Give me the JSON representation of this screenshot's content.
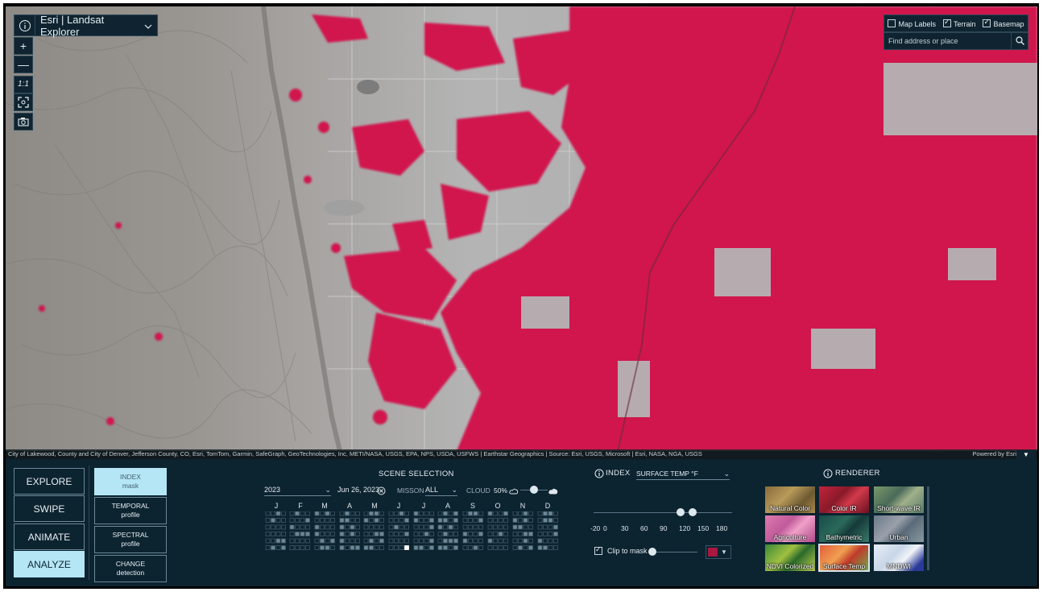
{
  "app": {
    "title": "Esri | Landsat Explorer"
  },
  "map": {
    "layer_toggles": [
      {
        "label": "Map Labels",
        "checked": false
      },
      {
        "label": "Terrain",
        "checked": true
      },
      {
        "label": "Basemap",
        "checked": true
      }
    ],
    "search_placeholder": "Find address or place",
    "attribution": "City of Lakewood, County and City of Denver, Jefferson County, CO, Esri, TomTom, Garmin, SafeGraph, GeoTechnologies, Inc, METI/NASA, USGS, EPA, NPS, USDA, USFWS | Earthstar Geographics | Source: Esri, USGS, Microsoft | Esri, NASA, NGA, USGS",
    "powered_by": "Powered by Esri",
    "zoom_in": "+",
    "zoom_out": "—",
    "scale_1to1": "1:1",
    "mask_color": "#d0124d"
  },
  "modes": [
    "EXPLORE",
    "SWIPE",
    "ANIMATE",
    "ANALYZE"
  ],
  "active_mode": "ANALYZE",
  "analyze_tools": [
    {
      "line1": "INDEX",
      "line2": "mask",
      "active": true
    },
    {
      "line1": "TEMPORAL",
      "line2": "profile",
      "active": false
    },
    {
      "line1": "SPECTRAL",
      "line2": "profile",
      "active": false
    },
    {
      "line1": "CHANGE",
      "line2": "detection",
      "active": false
    }
  ],
  "scene_selection": {
    "title": "SCENE SELECTION",
    "year": "2023",
    "date": "Jun 26, 2023",
    "mission_label": "MISSON",
    "mission_value": "ALL",
    "cloud_label": "CLOUD",
    "cloud_value": "50%",
    "months": [
      "J",
      "F",
      "M",
      "A",
      "M",
      "J",
      "J",
      "A",
      "S",
      "O",
      "N",
      "D"
    ]
  },
  "index": {
    "title": "INDEX",
    "selected": "SURFACE TEMP °F",
    "ticks": [
      "-20",
      "0",
      "30",
      "60",
      "90",
      "120",
      "150",
      "180"
    ],
    "range_low": 115,
    "range_high": 134,
    "clip_label": "Clip to mask",
    "clip_checked": true,
    "swatch_color": "#a8183f"
  },
  "renderer": {
    "title": "RENDERER",
    "tiles": [
      {
        "label": "Natural Color",
        "active": false
      },
      {
        "label": "Color IR",
        "active": false
      },
      {
        "label": "Short-wave IR",
        "active": false
      },
      {
        "label": "Agriculture",
        "active": false
      },
      {
        "label": "Bathymetric",
        "active": false
      },
      {
        "label": "Urban",
        "active": false
      },
      {
        "label": "NDVI Colorized",
        "active": false
      },
      {
        "label": "Surface Temp",
        "active": true
      },
      {
        "label": "MNDWI",
        "active": false
      }
    ]
  }
}
